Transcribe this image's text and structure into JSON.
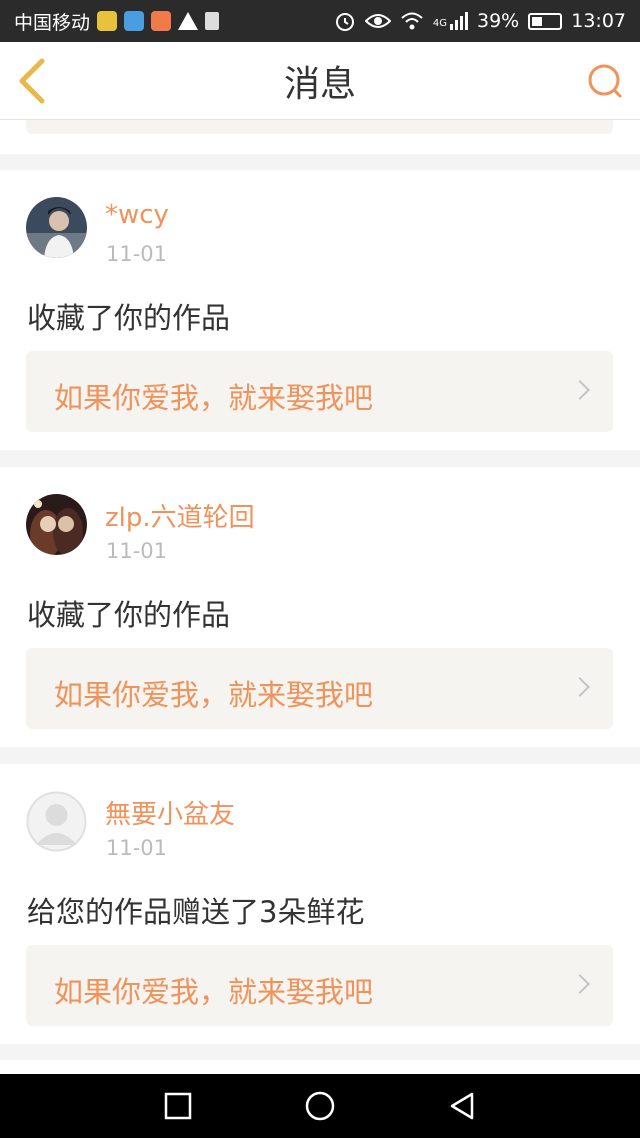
{
  "status_bar": {
    "carrier": "中国移动",
    "network_type": "4G",
    "battery": "39%",
    "time": "13:07"
  },
  "header": {
    "title": "消息",
    "back_icon": "chevron-left-icon",
    "search_icon": "search-icon"
  },
  "colors": {
    "accent": "#f0935a",
    "back_icon": "#e7b84a",
    "page_bg": "#f4f4f4"
  },
  "messages": [
    {
      "username": "*wcy",
      "date": "11-01",
      "text": "收藏了你的作品",
      "work_title": "如果你爱我，就来娶我吧",
      "avatar": "photo-avatar"
    },
    {
      "username": "zlp.六道轮回",
      "date": "11-01",
      "text": "收藏了你的作品",
      "work_title": "如果你爱我，就来娶我吧",
      "avatar": "photo-avatar"
    },
    {
      "username": "無要小盆友",
      "date": "11-01",
      "text": "给您的作品赠送了3朵鲜花",
      "work_title": "如果你爱我，就来娶我吧",
      "avatar": "default-avatar"
    }
  ],
  "nav_bar": {
    "items": [
      "recent-apps-icon",
      "home-icon",
      "back-icon"
    ]
  }
}
